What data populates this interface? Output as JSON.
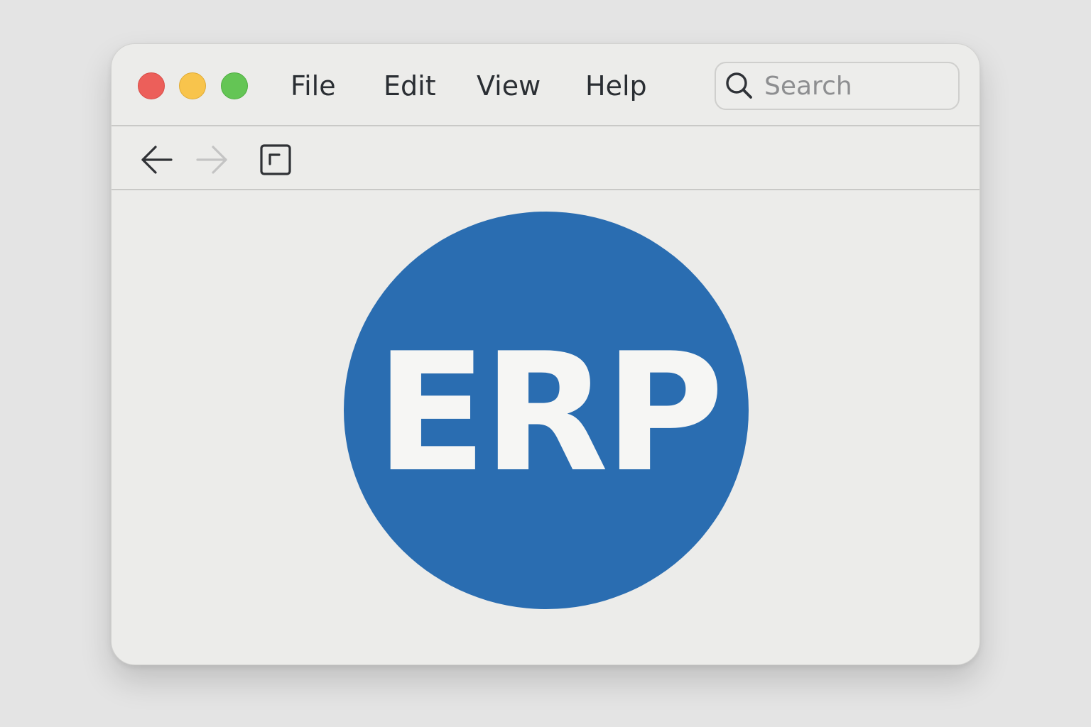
{
  "colors": {
    "close": "#ec5f5a",
    "close_border": "#d84c47",
    "minimize": "#f8c44c",
    "minimize_border": "#e0ab35",
    "zoom": "#64c555",
    "zoom_border": "#4fae42",
    "logo_fill": "#2a6db1",
    "logo_text": "#f6f6f4"
  },
  "menu": {
    "items": [
      {
        "label": "File"
      },
      {
        "label": "Edit"
      },
      {
        "label": "View"
      },
      {
        "label": "Help"
      }
    ]
  },
  "search": {
    "placeholder": "Search",
    "value": ""
  },
  "toolbar": {
    "back_icon": "arrow-left-icon",
    "forward_icon": "arrow-right-icon",
    "forward_disabled": true,
    "sidebar_icon": "square-icon"
  },
  "content": {
    "logo_text": "ERP"
  }
}
